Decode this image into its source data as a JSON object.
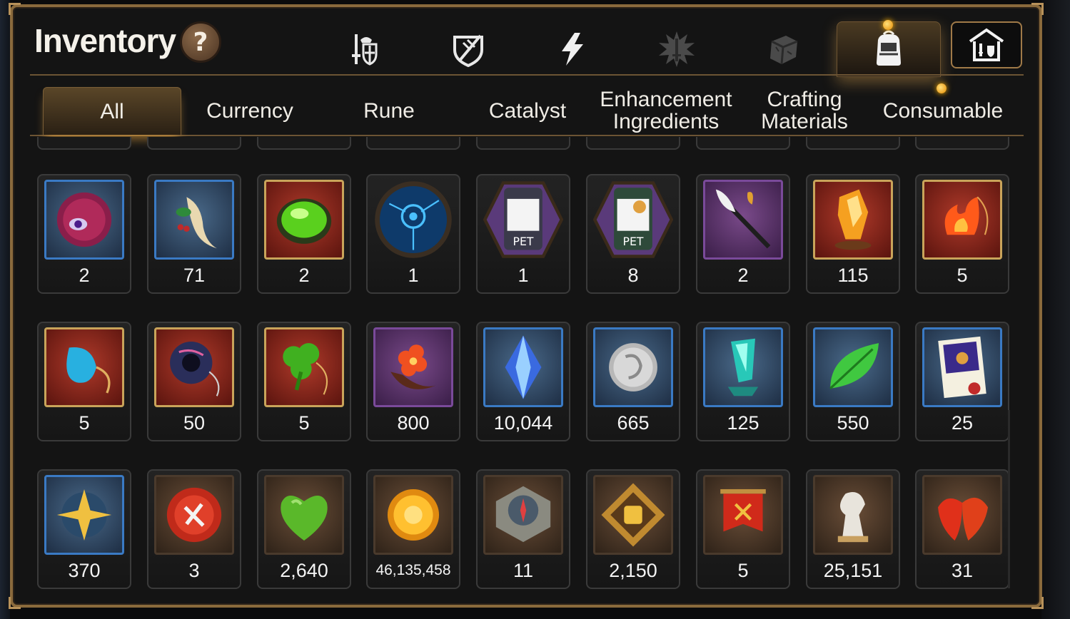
{
  "header": {
    "title": "Inventory",
    "help_label": "?"
  },
  "category_tabs": [
    {
      "name": "equipment",
      "icon": "sword-shield-icon",
      "active": false
    },
    {
      "name": "artifact",
      "icon": "broken-shield-icon",
      "active": false
    },
    {
      "name": "skill",
      "icon": "lightning-icon",
      "active": false
    },
    {
      "name": "exclusive",
      "icon": "burst-sword-icon",
      "active": false
    },
    {
      "name": "material",
      "icon": "cube-icon",
      "active": false
    },
    {
      "name": "items",
      "icon": "backpack-icon",
      "active": true,
      "notification": true
    },
    {
      "name": "storage",
      "icon": "storage-house-icon",
      "active": false
    }
  ],
  "subtabs": [
    {
      "label": "All",
      "active": true
    },
    {
      "label": "Currency",
      "active": false
    },
    {
      "label": "Rune",
      "active": false
    },
    {
      "label": "Catalyst",
      "active": false
    },
    {
      "label": "Enhancement\nIngredients",
      "active": false
    },
    {
      "label": "Crafting\nMaterials",
      "active": false
    },
    {
      "label": "Consumable",
      "active": false,
      "notification": true
    }
  ],
  "items": {
    "row1": [
      {
        "icon": "purple-eye-orb-icon",
        "frame": "blue",
        "count": "2"
      },
      {
        "icon": "ginseng-root-icon",
        "frame": "blue",
        "count": "71"
      },
      {
        "icon": "green-gem-icon",
        "frame": "gold",
        "count": "2"
      },
      {
        "icon": "blue-rune-circle-icon",
        "frame": "round",
        "count": "1"
      },
      {
        "icon": "pet-pack-icon",
        "frame": "hex",
        "count": "1"
      },
      {
        "icon": "pet-pack-cat-icon",
        "frame": "hex",
        "count": "8"
      },
      {
        "icon": "feather-staff-icon",
        "frame": "purple",
        "count": "2"
      },
      {
        "icon": "fire-crystal-icon",
        "frame": "gold",
        "count": "115"
      },
      {
        "icon": "flame-charm-icon",
        "frame": "gold",
        "count": "5"
      }
    ],
    "row2": [
      {
        "icon": "water-charm-icon",
        "frame": "gold",
        "count": "5"
      },
      {
        "icon": "cosmic-charm-icon",
        "frame": "gold",
        "count": "50"
      },
      {
        "icon": "clover-charm-icon",
        "frame": "gold",
        "count": "5"
      },
      {
        "icon": "flower-charm-icon",
        "frame": "purple",
        "count": "800"
      },
      {
        "icon": "blue-crystal-icon",
        "frame": "blue",
        "count": "10,044"
      },
      {
        "icon": "silver-coin-icon",
        "frame": "blue",
        "count": "665"
      },
      {
        "icon": "teal-crystal-icon",
        "frame": "blue",
        "count": "125"
      },
      {
        "icon": "green-leaf-icon",
        "frame": "blue",
        "count": "550"
      },
      {
        "icon": "certificate-icon",
        "frame": "blue",
        "count": "25"
      }
    ],
    "row3": [
      {
        "icon": "star-charm-icon",
        "frame": "blue",
        "count": "370"
      },
      {
        "icon": "red-badge-icon",
        "frame": "brown",
        "count": "3"
      },
      {
        "icon": "green-heart-icon",
        "frame": "brown",
        "count": "2,640"
      },
      {
        "icon": "gold-coin-icon",
        "frame": "brown",
        "count": "46,135,458"
      },
      {
        "icon": "stone-compass-icon",
        "frame": "brown",
        "count": "11"
      },
      {
        "icon": "fist-emblem-icon",
        "frame": "brown",
        "count": "2,150"
      },
      {
        "icon": "war-banner-icon",
        "frame": "brown",
        "count": "5"
      },
      {
        "icon": "knight-chess-icon",
        "frame": "brown",
        "count": "25,151"
      },
      {
        "icon": "red-leaves-icon",
        "frame": "brown",
        "count": "31"
      }
    ]
  },
  "colors": {
    "frame_gold": "#8a6a3c",
    "accent_glow": "#ffb300",
    "panel_bg": "#141414"
  }
}
